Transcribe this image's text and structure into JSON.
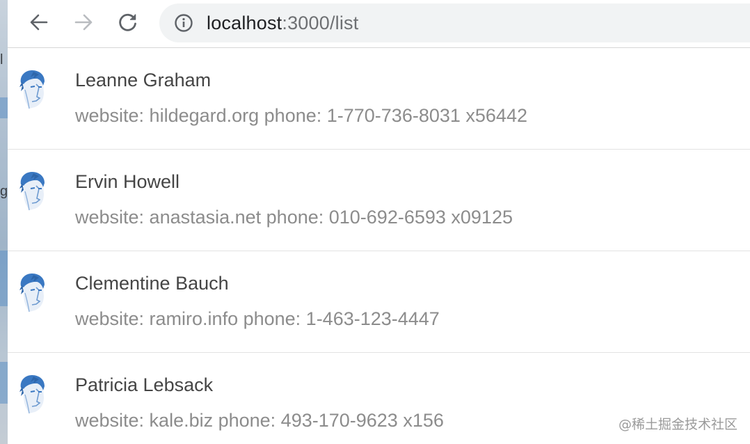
{
  "browser": {
    "back_icon": "arrow-left-icon",
    "forward_icon": "arrow-right-icon",
    "reload_icon": "reload-icon",
    "info_icon": "info-circle-icon",
    "url_host": "localhost",
    "url_rest": ":3000/list"
  },
  "left_edge": {
    "glyph_1": "l",
    "glyph_2": "g"
  },
  "list": {
    "items": [
      {
        "name": "Leanne Graham",
        "description": "website: hildegard.org phone: 1-770-736-8031 x56442"
      },
      {
        "name": "Ervin Howell",
        "description": "website: anastasia.net phone: 010-692-6593 x09125"
      },
      {
        "name": "Clementine Bauch",
        "description": "website: ramiro.info phone: 1-463-123-4447"
      },
      {
        "name": "Patricia Lebsack",
        "description": "website: kale.biz phone: 493-170-9623 x156"
      }
    ]
  },
  "watermark": "@稀土掘金技术社区",
  "colors": {
    "avatar_blue": "#3a78c2",
    "name_text": "#454545",
    "desc_text": "#8c8c8c",
    "omnibox_bg": "#f1f3f4"
  }
}
